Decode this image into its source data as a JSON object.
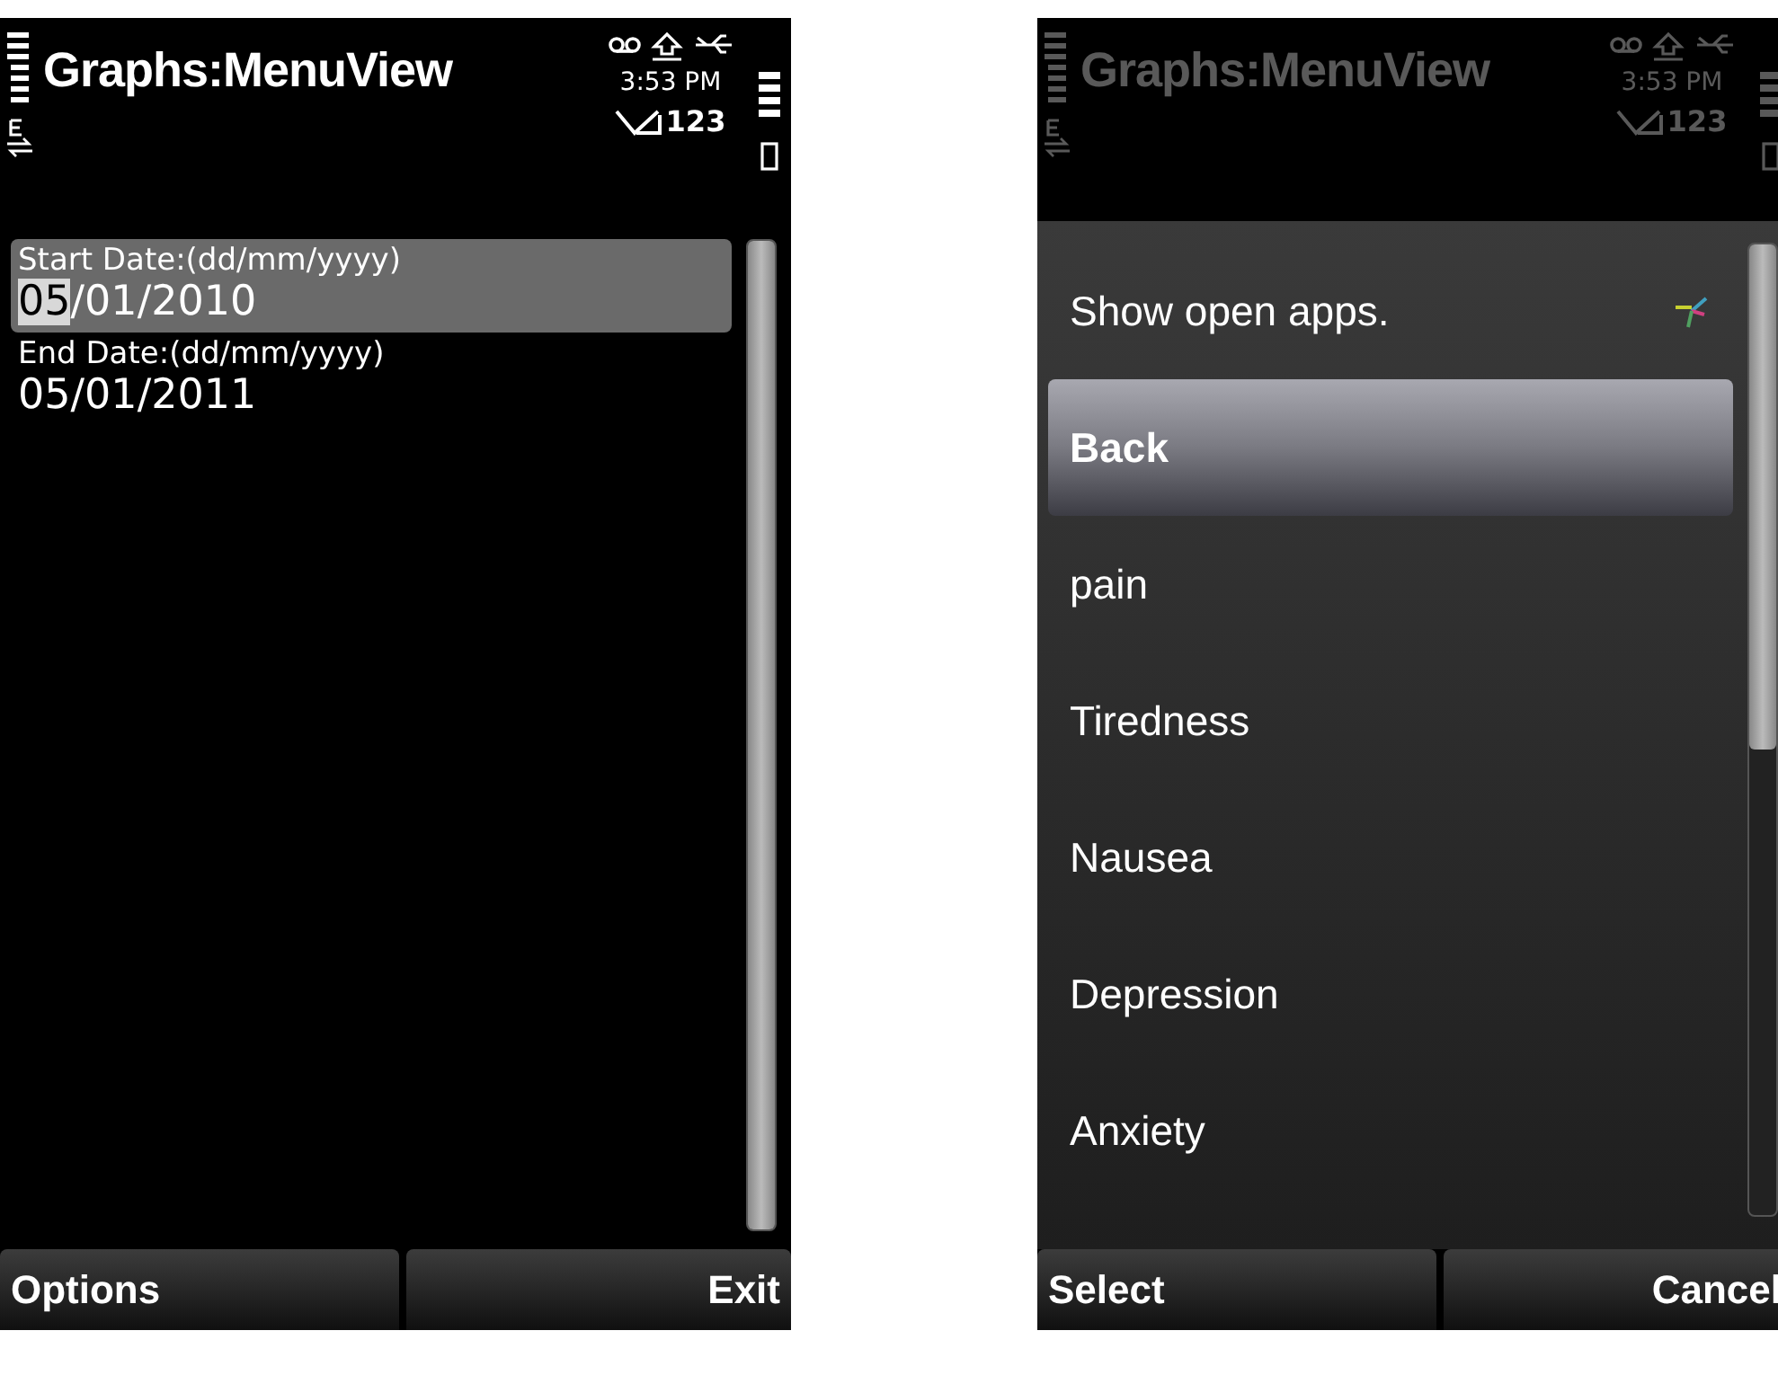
{
  "phones": [
    {
      "kind": "form",
      "dimmed": false,
      "status_bar": {
        "title": "Graphs:MenuView",
        "time": "3:53 PM",
        "counter": "123"
      },
      "fields": [
        {
          "label": "Start Date:(dd/mm/yyyy)",
          "value": "05/01/2010",
          "selected": true
        },
        {
          "label": "End Date:(dd/mm/yyyy)",
          "value": "05/01/2011",
          "selected": false
        }
      ],
      "softkeys": [
        "Options",
        "Exit"
      ]
    },
    {
      "kind": "menu",
      "dimmed": true,
      "status_bar": {
        "title": "Graphs:MenuView",
        "time": "3:53 PM",
        "counter": "123"
      },
      "menu_items": [
        {
          "label": "Show open apps.",
          "selected": false,
          "kind": "apps"
        },
        {
          "label": "Back",
          "selected": true,
          "kind": "plain"
        },
        {
          "label": "pain",
          "selected": false,
          "kind": "plain"
        },
        {
          "label": "Tiredness",
          "selected": false,
          "kind": "plain"
        },
        {
          "label": "Nausea",
          "selected": false,
          "kind": "plain"
        },
        {
          "label": "Depression",
          "selected": false,
          "kind": "plain"
        },
        {
          "label": "Anxiety",
          "selected": false,
          "kind": "plain"
        }
      ],
      "softkeys": [
        "Select",
        "Cancel"
      ]
    }
  ]
}
